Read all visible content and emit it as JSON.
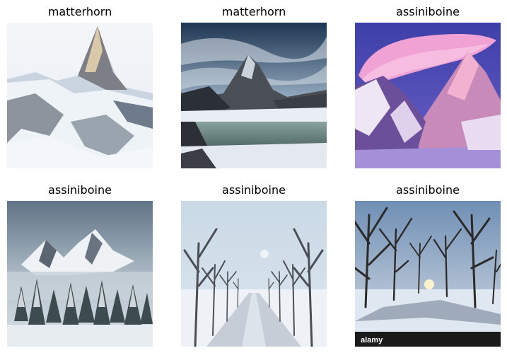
{
  "images": [
    {
      "label": "matterhorn",
      "scene": "snowy-peak-photo"
    },
    {
      "label": "matterhorn",
      "scene": "peak-lake-photo"
    },
    {
      "label": "assiniboine",
      "scene": "pink-cloud-peaks-photo"
    },
    {
      "label": "assiniboine",
      "scene": "misty-forest-peaks-photo"
    },
    {
      "label": "assiniboine",
      "scene": "snowy-road-trees-photo"
    },
    {
      "label": "assiniboine",
      "scene": "winter-park-sunset-photo"
    }
  ],
  "watermark": "alamy"
}
